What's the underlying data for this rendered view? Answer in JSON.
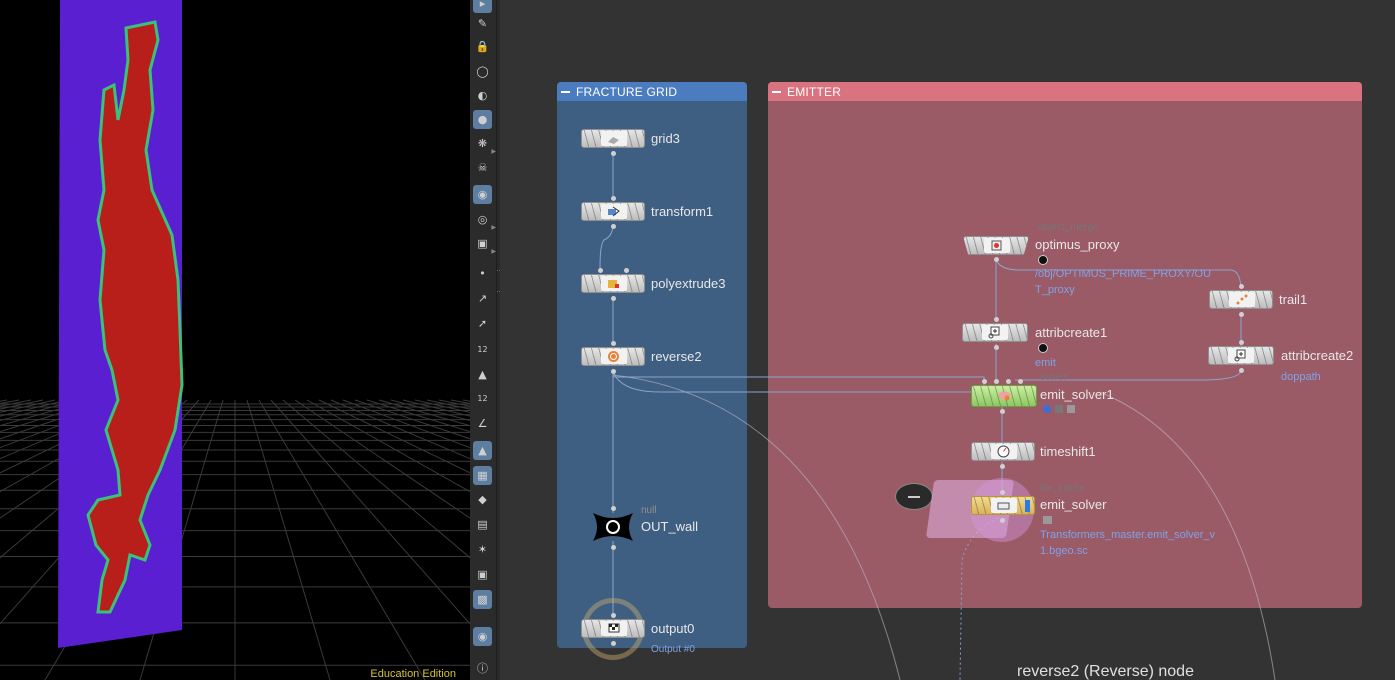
{
  "viewport": {
    "edition_label": "Education Edition",
    "colors": {
      "background": "#000000",
      "wall_purple": "#5a1fd0",
      "shape_red": "#b81f1a",
      "edge_green": "#38c27a"
    }
  },
  "toolbar": {
    "icons": [
      "select-icon",
      "edit-icon",
      "lock-icon",
      "ghost-icon",
      "shade-icon",
      "light-icon",
      "lightbulb-icon",
      "skull-icon",
      "camera-icon",
      "eye-icon",
      "render-icon",
      "point-icon",
      "brush-icon",
      "pin-icon",
      "measure-12-icon",
      "paint-icon",
      "measure-12b-icon",
      "angle-icon",
      "wand-icon",
      "texture-icon",
      "diamond-icon",
      "map-icon",
      "gizmo-icon",
      "box-icon",
      "image-icon",
      "location-icon",
      "info-icon"
    ]
  },
  "network": {
    "colors": {
      "fracture_grid_bg": "#3f5f82",
      "fracture_grid_header": "#4a7cbf",
      "emitter_bg": "#9a5a66",
      "emitter_header": "#d8737f",
      "wire": "#8aa6cf",
      "solver_green": "#a8e07a",
      "cache_yellow": "#e8c86a",
      "link_blue": "#7fa3ea"
    },
    "boxes": {
      "fracture_grid": {
        "title": "FRACTURE GRID"
      },
      "emitter": {
        "title": "EMITTER"
      }
    },
    "nodes": {
      "grid3": {
        "name": "grid3",
        "icon": "grid-icon"
      },
      "transform1": {
        "name": "transform1",
        "icon": "transform-icon"
      },
      "polyextrude3": {
        "name": "polyextrude3",
        "icon": "extrude-icon"
      },
      "reverse2": {
        "name": "reverse2",
        "icon": "reverse-icon"
      },
      "out_wall": {
        "name": "OUT_wall",
        "type": "null"
      },
      "output0": {
        "name": "output0",
        "sub": "Output #0"
      },
      "optimus_proxy": {
        "name": "optimus_proxy",
        "type": "object_merge",
        "sub": "/obj/OPTIMUS_PRIME_PROXY/OUT_proxy"
      },
      "trail1": {
        "name": "trail1"
      },
      "attribcreate1": {
        "name": "attribcreate1",
        "sub": "emit"
      },
      "attribcreate2": {
        "name": "attribcreate2",
        "sub": "doppath"
      },
      "emit_solver1": {
        "name": "emit_solver1",
        "type": "solver"
      },
      "timeshift1": {
        "name": "timeshift1"
      },
      "emit_solver": {
        "name": "emit_solver",
        "type": "file_cache",
        "sub": "Transformers_master.emit_solver_v1.bgeo.sc"
      }
    },
    "footer": "reverse2 (Reverse) node"
  }
}
